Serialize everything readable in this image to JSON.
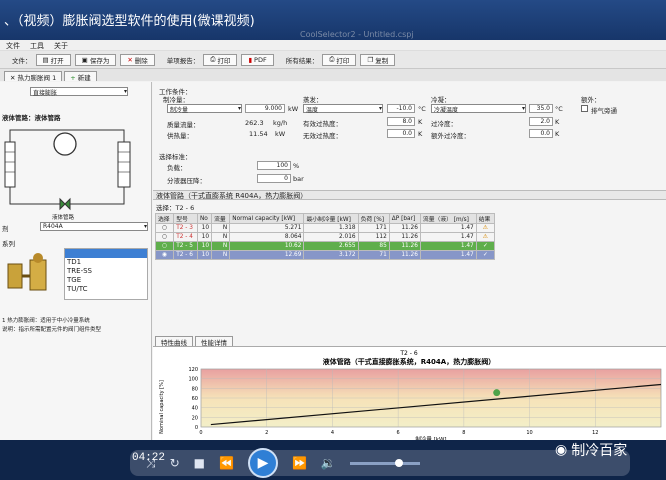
{
  "video_title": "、（视频）膨胀阀选型软件的使用(微课视频)",
  "app": {
    "title": "CoolSelector2 - Untitled.cspj",
    "menu": [
      "文件",
      "工具",
      "关于"
    ],
    "toolbar": {
      "file_label": "文件：",
      "open": "打开",
      "save_as": "保存为",
      "delete": "删除",
      "single_report_label": "单项报告：",
      "print": "打印",
      "pdf": "PDF",
      "project_report_label": "所有结果：",
      "print2": "打印",
      "copy": "复制"
    },
    "tabs": [
      "热力膨胀阀 1",
      "新建"
    ]
  },
  "left": {
    "select_app": "直接膨胀",
    "circuit_title": "液体管路：液体管路",
    "valve_label": "液体管路",
    "refrigerant_label": "剂",
    "refrigerant_value": "R404A",
    "series_label": "系列",
    "series_list": [
      "TD1",
      "TRE-SS",
      "TGE",
      "TU/TC"
    ],
    "notes": [
      "1 热力膨胀阀：适用于中小冷量系统",
      "说明：指示所需配置元件的阀门组件类型"
    ]
  },
  "conditions": {
    "work_title": "工作条件：",
    "cap_title": "制冷量：",
    "cap_select": "制冷量",
    "cap_value": "9.000",
    "cap_unit": "kW",
    "mass_flow_label": "质量流量：",
    "mass_flow_value": "262.3",
    "mass_flow_unit": "kg/h",
    "heat_label": "供热量：",
    "heat_value": "11.54",
    "heat_unit": "kW",
    "evap_title": "蒸发：",
    "evap_select": "温度",
    "evap_value": "-10.0",
    "evap_unit": "°C",
    "superheat_label": "有效过热度：",
    "superheat_value": "8.0",
    "superheat_unit": "K",
    "extra_sh_label": "无效过热度：",
    "extra_sh_value": "0.0",
    "extra_sh_unit": "K",
    "cond_title": "冷凝：",
    "cond_select": "冷凝温度",
    "cond_value": "35.0",
    "cond_unit": "°C",
    "subcool_label": "过冷度：",
    "subcool_value": "2.0",
    "subcool_unit": "K",
    "extra_sc_label": "额外过冷度：",
    "extra_sc_value": "0.0",
    "extra_sc_unit": "K",
    "extra_title": "额外：",
    "bypass_label": "排气旁通",
    "sel_title": "选择标准：",
    "load_label": "负载：",
    "load_value": "100",
    "load_unit": "%",
    "press_label": "分液器压降：",
    "press_value": "0",
    "press_unit": "bar"
  },
  "results": {
    "header": "液体管路（干式直膨系统 R404A，热力膨胀阀）",
    "selection_label": "选择：",
    "selection_value": "T2 - 6",
    "columns": [
      "选择",
      "型号",
      "No",
      "流量",
      "Normal capacity [kW]",
      "最小制冷量 [kW]",
      "负荷 [%]",
      "ΔP [bar]",
      "流量（液） [m/s]",
      "结果"
    ],
    "rows": [
      [
        "",
        "T2 - 3",
        "10",
        "N",
        "5.271",
        "1.318",
        "171",
        "11.26",
        "1.47",
        "⚠"
      ],
      [
        "",
        "T2 - 4",
        "10",
        "N",
        "8.064",
        "2.016",
        "112",
        "11.26",
        "1.47",
        "⚠"
      ],
      [
        "",
        "T2 - 5",
        "10",
        "N",
        "10.62",
        "2.655",
        "85",
        "11.26",
        "1.47",
        "✓"
      ],
      [
        "",
        "T2 - 6",
        "10",
        "N",
        "12.69",
        "3.172",
        "71",
        "11.26",
        "1.47",
        "✓"
      ]
    ]
  },
  "chart_tabs": [
    "特性曲线",
    "性能详情"
  ],
  "chart_data": {
    "type": "line",
    "title": "T2 - 6",
    "subtitle": "液体管路（干式直接膨胀系统，R404A，热力膨胀阀）",
    "xlabel": "制冷量 [kW]",
    "ylabel": "Nominal capacity [%]",
    "xlim": [
      0,
      14
    ],
    "ylim": [
      0,
      120
    ],
    "xticks": [
      0,
      2,
      4,
      6,
      8,
      10,
      12
    ],
    "yticks": [
      0,
      20,
      40,
      60,
      80,
      100,
      120
    ],
    "series": [
      {
        "values": [
          [
            0.3,
            5
          ],
          [
            14,
            88
          ]
        ]
      }
    ],
    "marker": {
      "x": 9.0,
      "y": 71
    },
    "grid": true
  },
  "player": {
    "time": "04:22",
    "watermark": "制冷百家"
  },
  "status": {
    "cap": "9.000 kW",
    "heat": "11.54 kW"
  }
}
